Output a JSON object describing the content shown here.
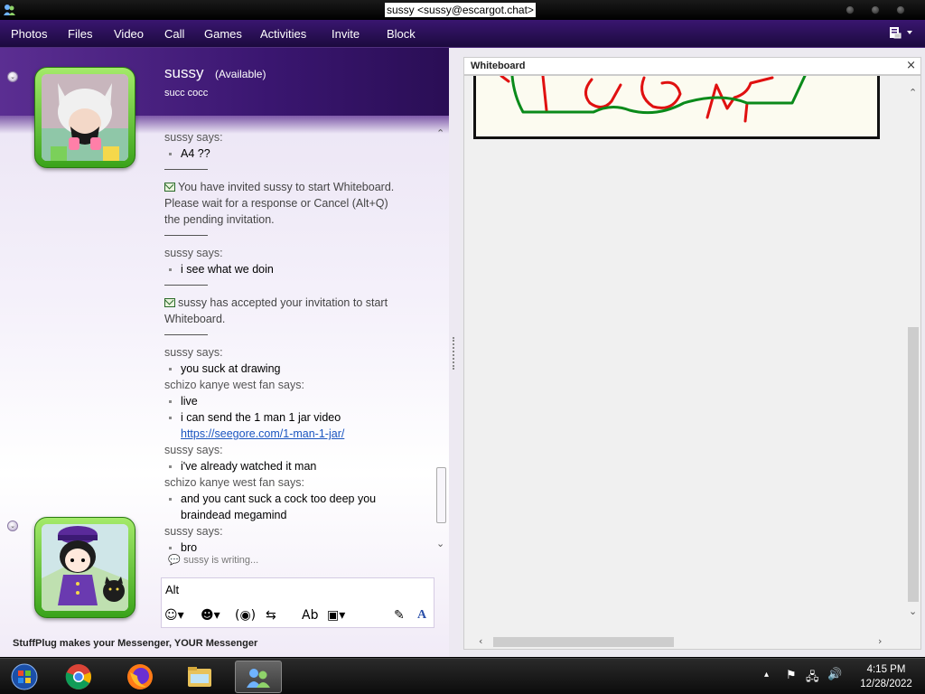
{
  "window": {
    "title": "sussy <sussy@escargot.chat>"
  },
  "menu": {
    "items": [
      "Photos",
      "Files",
      "Video",
      "Call",
      "Games",
      "Activities",
      "Invite",
      "Block"
    ]
  },
  "contact": {
    "name": "sussy",
    "status": "(Available)",
    "psm": "succ cocc"
  },
  "conversation": {
    "blocks": [
      {
        "type": "says",
        "text": "sussy says:"
      },
      {
        "type": "msg",
        "text": "A4 ??"
      },
      {
        "type": "sep"
      },
      {
        "type": "sys",
        "lines": [
          "You have invited sussy to start Whiteboard.",
          "Please wait for a response or Cancel (Alt+Q)",
          "the pending invitation."
        ]
      },
      {
        "type": "sep"
      },
      {
        "type": "says",
        "text": "sussy says:"
      },
      {
        "type": "msg",
        "text": "i see what we doin"
      },
      {
        "type": "sep"
      },
      {
        "type": "sys",
        "lines": [
          "sussy has accepted your invitation to start",
          "Whiteboard."
        ]
      },
      {
        "type": "sep"
      },
      {
        "type": "says",
        "text": "sussy says:"
      },
      {
        "type": "msg",
        "text": "you suck at drawing"
      },
      {
        "type": "says",
        "text": "schizo kanye west fan says:"
      },
      {
        "type": "msg",
        "text": "live"
      },
      {
        "type": "msg",
        "text": "i can send the 1 man 1 jar video"
      },
      {
        "type": "link",
        "text": "https://seegore.com/1-man-1-jar/"
      },
      {
        "type": "says",
        "text": "sussy says:"
      },
      {
        "type": "msg",
        "text": "i've already watched it man"
      },
      {
        "type": "says",
        "text": "schizo kanye west fan says:"
      },
      {
        "type": "msg",
        "text": "and you cant suck a cock too deep you"
      },
      {
        "type": "cont",
        "text": "braindead megamind"
      },
      {
        "type": "says",
        "text": "sussy says:"
      },
      {
        "type": "msg",
        "text": "bro"
      }
    ],
    "typing": "sussy is writing..."
  },
  "input": {
    "value": "Alt"
  },
  "footer": {
    "text": "StuffPlug makes your Messenger, YOUR Messenger"
  },
  "whiteboard": {
    "title": "Whiteboard",
    "close": "×"
  },
  "taskbar": {
    "apps": [
      "start-orb-icon",
      "chrome-icon",
      "firefox-icon",
      "file-explorer-icon",
      "messenger-icon"
    ],
    "time": "4:15 PM",
    "date": "12/28/2022"
  },
  "colors": {
    "menubar": "#2a0f55",
    "avatar_frame": "#5cc22e",
    "whiteboard_red": "#e01010",
    "whiteboard_green": "#0a8a1a"
  }
}
